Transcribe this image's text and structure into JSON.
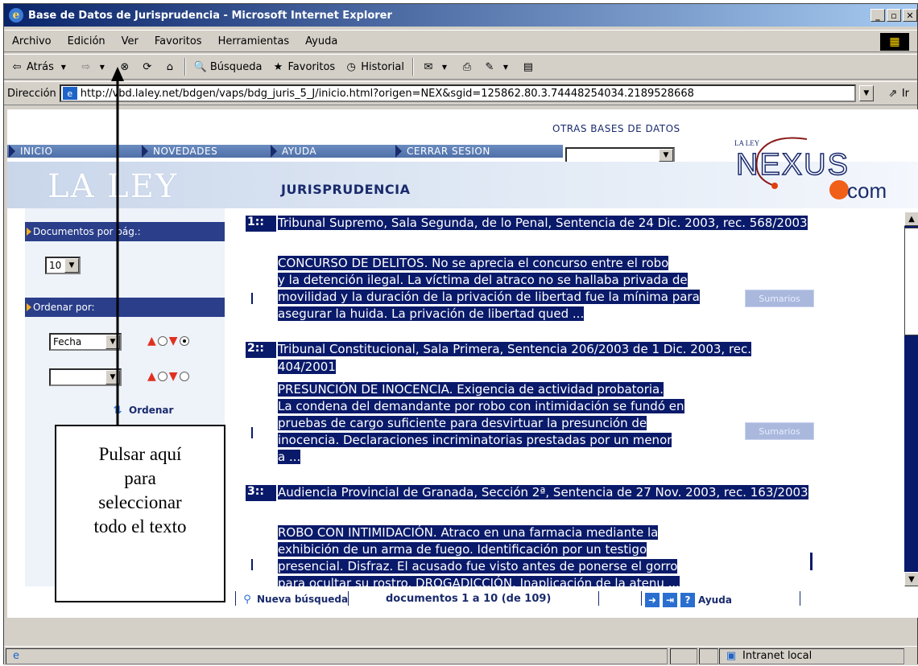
{
  "window": {
    "title": "Base de Datos de Jurisprudencia - Microsoft Internet Explorer"
  },
  "menu": [
    "Archivo",
    "Edición",
    "Ver",
    "Favoritos",
    "Herramientas",
    "Ayuda"
  ],
  "toolbar": {
    "back": "Atrás",
    "search": "Búsqueda",
    "favorites": "Favoritos",
    "history": "Historial"
  },
  "address": {
    "label": "Dirección",
    "url": "http://vbd.laley.net/bdgen/vaps/bdg_juris_5_J/inicio.html?origen=NEX&sgid=125862.80.3.74448254034.2189528668",
    "go": "Ir"
  },
  "site": {
    "nav_tabs": [
      "INICIO",
      "NOVEDADES",
      "AYUDA",
      "CERRAR SESION"
    ],
    "otras_bases": "OTRAS BASES DE DATOS",
    "logo": "LA LEY",
    "section_title": "JURISPRUDENCIA",
    "nexus_small": "LA LEY",
    "nexus": "NEXUS",
    "nexus_com": "com"
  },
  "left": {
    "docs_label": "Documentos por pág.:",
    "docs_value": "10",
    "order_label": "Ordenar por:",
    "order_value": "Fecha",
    "order_btn": "Ordenar"
  },
  "results": [
    {
      "num": "1::",
      "title": "Tribunal Supremo, Sala Segunda, de lo Penal, Sentencia de 24 Dic. 2003, rec. 568/2003",
      "lines": [
        "CONCURSO DE DELITOS. No se aprecia el concurso entre el robo",
        "y la detención ilegal. La víctima del atraco no se hallaba privada de",
        "movilidad y la duración de la privación de libertad fue la mínima para",
        "asegurar la huida. La privación de libertad qued ..."
      ],
      "sumarios": "Sumarios"
    },
    {
      "num": "2::",
      "title": "Tribunal Constitucional, Sala Primera, Sentencia 206/2003 de 1 Dic. 2003, rec. 404/2001",
      "lines": [
        "PRESUNCIÓN DE INOCENCIA. Exigencia de actividad probatoria.",
        "La condena del demandante por robo con intimidación se fundó en",
        "pruebas de cargo suficiente para desvirtuar la presunción de",
        "inocencia. Declaraciones incriminatorias prestadas por un menor",
        "a ..."
      ],
      "sumarios": "Sumarios"
    },
    {
      "num": "3::",
      "title": "Audiencia Provincial de Granada, Sección 2ª, Sentencia de 27 Nov. 2003, rec. 163/2003",
      "lines": [
        "ROBO CON INTIMIDACIÓN. Atraco en una farmacia mediante la",
        "exhibición de un arma de fuego. Identificación por un testigo",
        "presencial. Disfraz. El acusado fue visto antes de ponerse el gorro",
        "para ocultar su rostro. DROGADICCIÓN. Inaplicación de la atenu ..."
      ]
    }
  ],
  "bottom": {
    "new_search": "Nueva búsqueda",
    "range": "documentos 1 a 10 (de 109)",
    "help": "Ayuda"
  },
  "status": {
    "zone": "Intranet local"
  },
  "annotation": {
    "lines": [
      "Pulsar aquí",
      "para",
      "seleccionar",
      "todo el texto"
    ]
  }
}
